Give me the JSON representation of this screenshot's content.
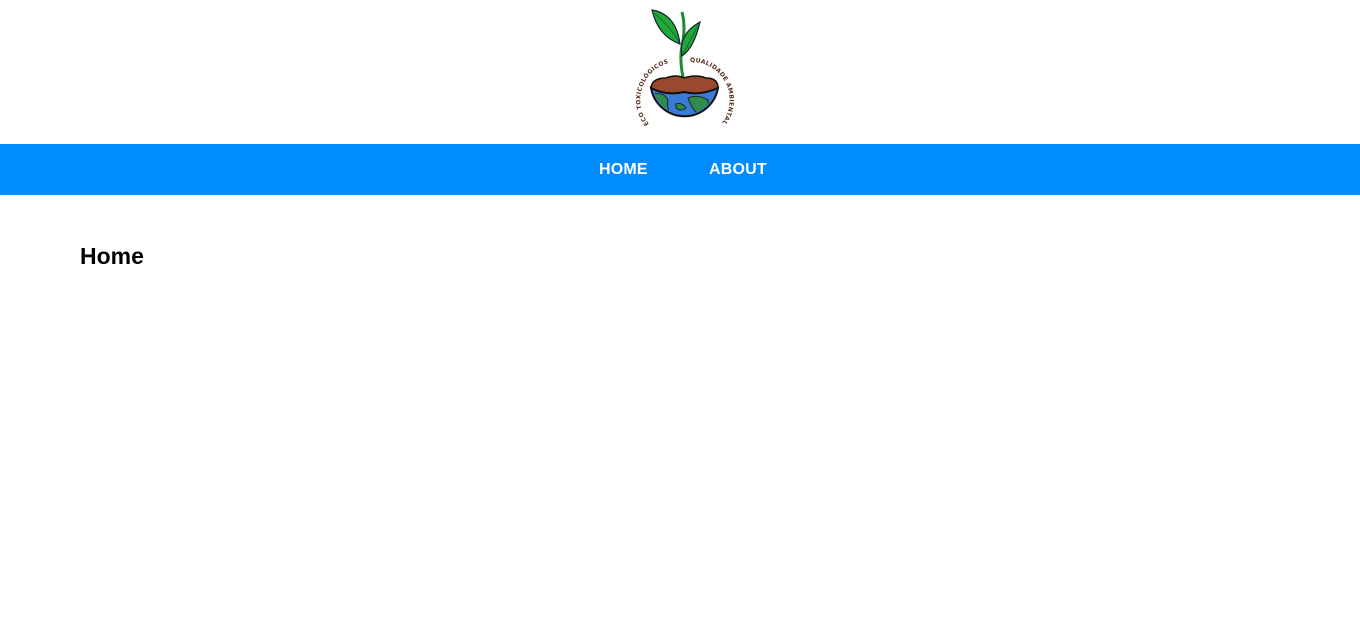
{
  "logo": {
    "text_left": "ECO TOXICOLÓGICOS",
    "text_right": "QUALIDADE AMBIENTAL"
  },
  "nav": {
    "items": [
      {
        "label": "HOME"
      },
      {
        "label": "ABOUT"
      }
    ]
  },
  "main": {
    "title": "Home"
  },
  "colors": {
    "nav_background": "#008cff",
    "nav_text": "#ffffff",
    "leaf": "#22a83a",
    "soil": "#9a4a2c",
    "ocean": "#3a7bd5",
    "land": "#2e8b4a"
  }
}
